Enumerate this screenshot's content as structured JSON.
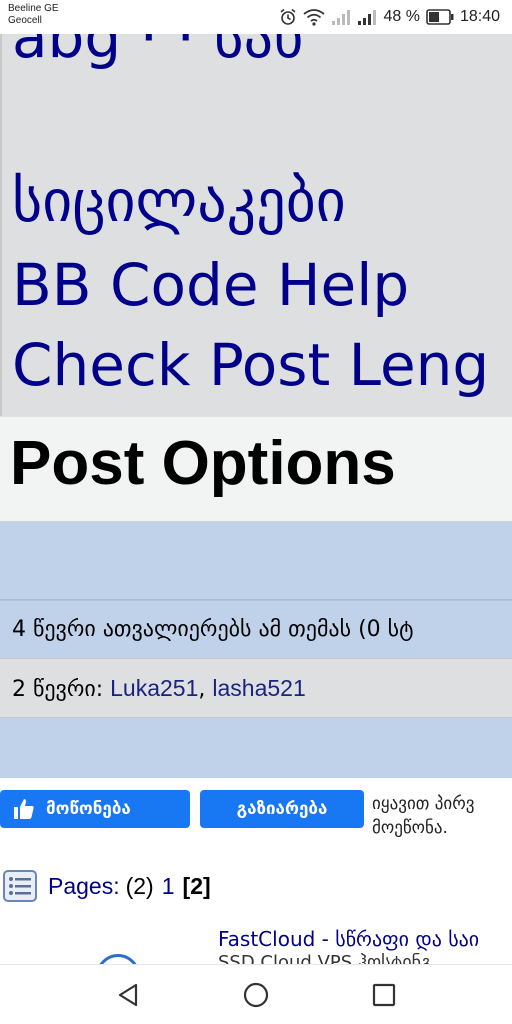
{
  "status_bar": {
    "carrier_1": "Beeline GE",
    "carrier_2": "Geocell",
    "battery": "48 %",
    "time": "18:40",
    "icons": [
      "alarm-icon",
      "wifi-icon",
      "signal-icon-1",
      "signal-icon-2",
      "battery-icon"
    ]
  },
  "post_options_links": {
    "top_partial": "abg · ·  სახ",
    "smileys": "სიცილაკები",
    "bbcode": "BB Code Help",
    "check_length": "Check Post Leng"
  },
  "post_options_header": "Post Options",
  "viewers": {
    "text": "4 წევრი ათვალიერებს ამ თემას (0 სტ"
  },
  "members": {
    "prefix": "2 წევრი: ",
    "users": [
      "Luka251",
      "lasha521"
    ],
    "separator": ", "
  },
  "facebook": {
    "like_label": "მოწონება",
    "share_label": "გაზიარება",
    "note_line_1": "იყავით პირვ",
    "note_line_2": "მოეწონა."
  },
  "pagination": {
    "label": "Pages:",
    "count": "(2)",
    "link_page": "1",
    "current_page": "[2]"
  },
  "ad": {
    "title": "FastCloud - სწრაფი და საი",
    "subtitle": "SSD Cloud VPS ჰოსტინგ"
  },
  "colors": {
    "link_blue": "#00008b",
    "band_blue": "#c0d1ea",
    "gray_panel": "#dedfe1",
    "facebook_blue": "#1877f2"
  }
}
